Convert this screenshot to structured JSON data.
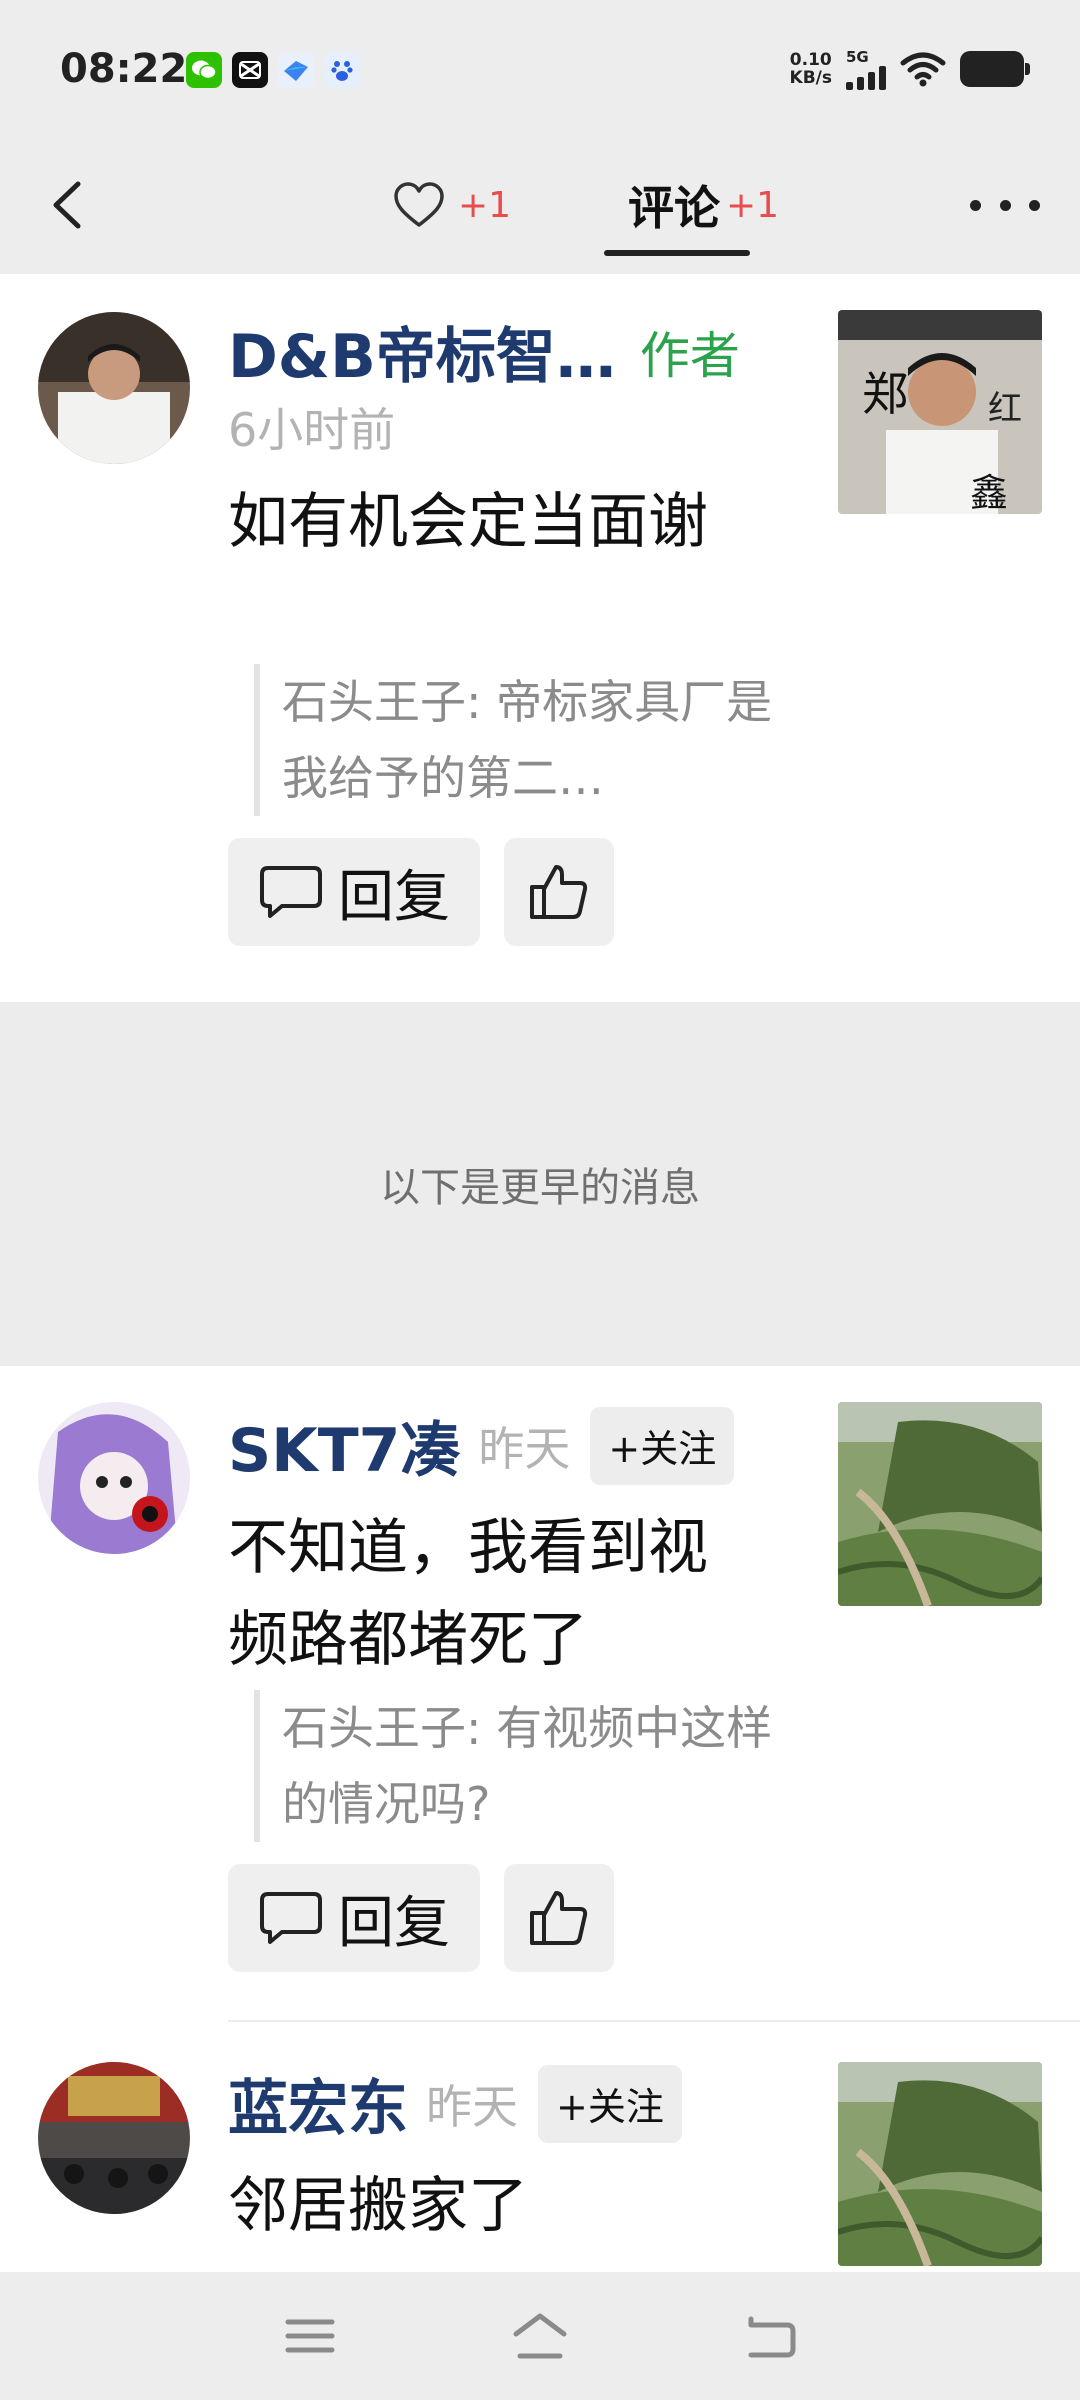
{
  "status_bar": {
    "time": "08:22",
    "net_speed_value": "0.10",
    "net_speed_unit": "KB/s",
    "network": "5G",
    "app_icons": [
      "wechat-icon",
      "capcut-icon",
      "feishu-icon",
      "baidu-icon"
    ]
  },
  "header": {
    "likes_plus": "+1",
    "comments_label": "评论",
    "comments_plus": "+1"
  },
  "comments": [
    {
      "name": "D&B帝标智…",
      "tag": "作者",
      "time": "6小时前",
      "text": "如有机会定当面谢",
      "quote": "石头王子: 帝标家具厂是我给予的第二…",
      "reply_label": "回复"
    },
    {
      "name": "SKT7凑",
      "time": "昨天",
      "follow_label": "+关注",
      "text": "不知道，我看到视频路都堵死了",
      "quote": "石头王子: 有视频中这样的情况吗?",
      "reply_label": "回复"
    },
    {
      "name": "蓝宏东",
      "time": "昨天",
      "follow_label": "+关注",
      "text": "邻居搬家了"
    }
  ],
  "earlier_divider": "以下是更早的消息",
  "colors": {
    "name": "#1e3a6e",
    "author_tag": "#2ba24c",
    "plus": "#e84d4d",
    "background_bar": "#ededed"
  }
}
